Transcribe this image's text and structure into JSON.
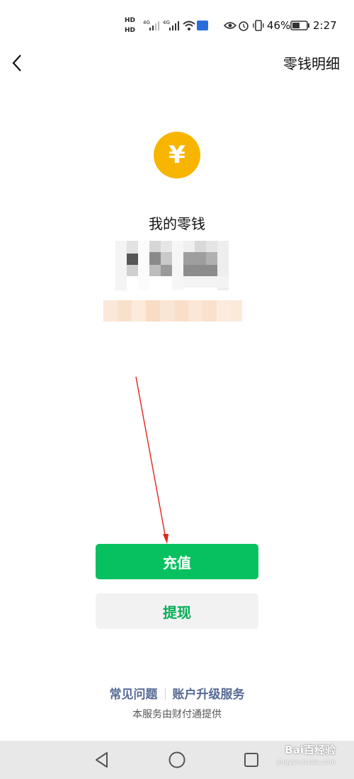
{
  "status_bar": {
    "hd1": "HD",
    "hd2": "HD",
    "sim1": "4G",
    "sim2": "4G",
    "battery": "46%",
    "time": "2:27",
    "signal_icons": [
      "signal-icon",
      "wifi-icon",
      "hotspot-icon",
      "eye-icon",
      "alarm-icon",
      "vibrate-icon",
      "battery-icon"
    ]
  },
  "nav": {
    "title": "零钱明细",
    "back_icon": "chevron-left-icon"
  },
  "wallet": {
    "yuan_symbol": "¥",
    "label": "我的零钱"
  },
  "actions": {
    "recharge": "充值",
    "withdraw": "提现"
  },
  "footer": {
    "faq": "常见问题",
    "upgrade": "账户升级服务",
    "provider": "本服务由财付通提供"
  },
  "system_nav": [
    "back-triangle-icon",
    "home-circle-icon",
    "recents-square-icon"
  ],
  "watermark": {
    "main": "Bai百经验",
    "sub": "jingyan.baidu.com"
  },
  "colors": {
    "primary_green": "#07c160",
    "secondary_bg": "#f2f2f2",
    "secondary_text": "#06ae56",
    "link_blue": "#576b95",
    "yuan_gold": "#f7b500",
    "annotation_red": "#e0241b"
  }
}
